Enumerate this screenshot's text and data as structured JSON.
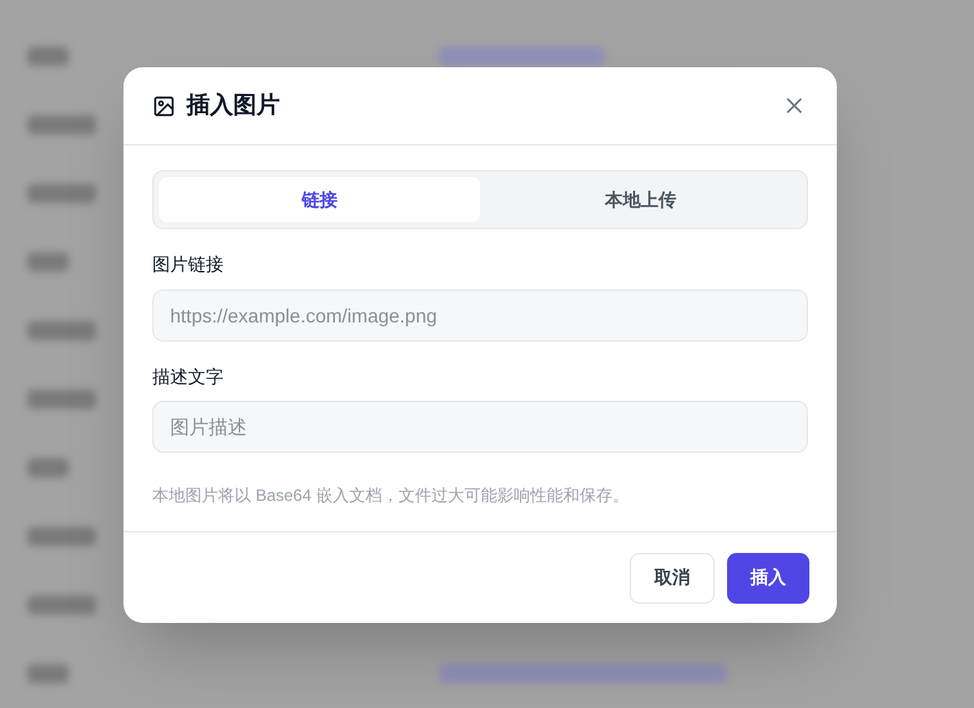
{
  "dialog": {
    "title": "插入图片",
    "tabs": [
      {
        "label": "链接",
        "selected": true
      },
      {
        "label": "本地上传",
        "selected": false
      }
    ],
    "fields": [
      {
        "label": "图片链接",
        "placeholder": "https://example.com/image.png"
      },
      {
        "label": "描述文字",
        "placeholder": "图片描述"
      }
    ],
    "hint": "本地图片将以 Base64 嵌入文档，文件过大可能影响性能和保存。",
    "buttons": [
      {
        "label": "取消",
        "kind": "secondary"
      },
      {
        "label": "插入",
        "kind": "primary"
      }
    ]
  }
}
